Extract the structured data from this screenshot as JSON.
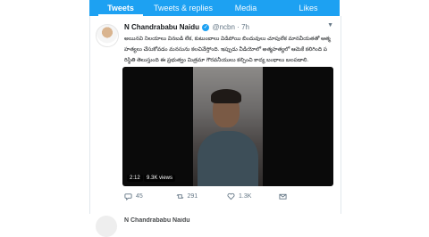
{
  "tabs": [
    "Tweets",
    "Tweets & replies",
    "Media",
    "Likes"
  ],
  "tweet": {
    "author": "N Chandrababu Naidu",
    "handle": "@ncbn",
    "time": "· 7h",
    "text": "అయినవి నిలయాలు వినబడి లేక, కుటుంబాలు విడిపోయి బిందువులు చూపులేక మానవీయతతో ఆత్మ హత్యలు చేసుకోవడం మనసును కలచివేస్తోంది. ఇప్పుడు వీడియోలో అత్మహత్యలో ఆమెకే కలిగింది పరిస్థితి తెలుస్తుంది ఈ ప్రభుత్వం మిత్రమా గౌరవనీయులు కల్పించి కాద్య బంధాలు బలపడాలి.",
    "video": {
      "duration": "2:12",
      "views": "9.3K views"
    },
    "actions": {
      "replies": "45",
      "retweets": "291",
      "likes": "1.3K"
    }
  },
  "next_tweet": {
    "author": "N Chandrababu Naidu"
  }
}
